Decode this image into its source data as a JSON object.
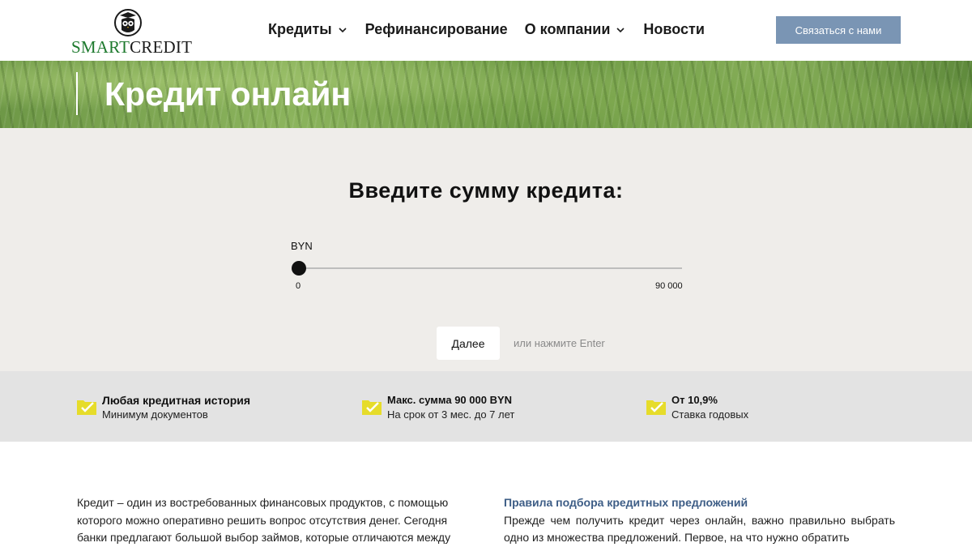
{
  "brand": {
    "name_part1": "SMART",
    "name_part2": "CREDIT",
    "colors": {
      "green": "#1e7a2e",
      "dark": "#1a1a1a"
    }
  },
  "nav": {
    "items": [
      {
        "label": "Кредиты",
        "has_dropdown": true
      },
      {
        "label": "Рефинансирование",
        "has_dropdown": false
      },
      {
        "label": "О компании",
        "has_dropdown": true
      },
      {
        "label": "Новости",
        "has_dropdown": false
      }
    ],
    "contact_button": "Связаться с нами",
    "contact_color": "#7a95b4"
  },
  "hero": {
    "title": "Кредит онлайн"
  },
  "calculator": {
    "heading": "Введите сумму кредита:",
    "currency": "BYN",
    "slider": {
      "min_label": "0",
      "max_label": "90 000",
      "value": 0
    },
    "next_button": "Далее",
    "enter_hint": "или нажмите Enter"
  },
  "features": [
    {
      "icon": "check-folder-icon",
      "title": "Любая кредитная история",
      "subtitle": "Минимум документов"
    },
    {
      "icon": "check-folder-icon",
      "title": "Макс. сумма 90 000 BYN",
      "subtitle": "На срок от 3 мес. до 7 лет"
    },
    {
      "icon": "check-folder-icon",
      "title": "От 10,9%",
      "subtitle": "Ставка годовых"
    }
  ],
  "feature_icon_color": "#e6dc2a",
  "article": {
    "left_text": "Кредит – один из востребованных финансовых продуктов, с помощью которого можно оперативно решить вопрос отсутствия денег. Сегодня банки предлагают большой выбор займов, которые отличаются между",
    "right_heading": "Правила подбора кредитных предложений",
    "right_text": "Прежде чем получить кредит через онлайн, важно правильно выбрать одно из множества предложений. Первое, на что нужно обратить"
  }
}
